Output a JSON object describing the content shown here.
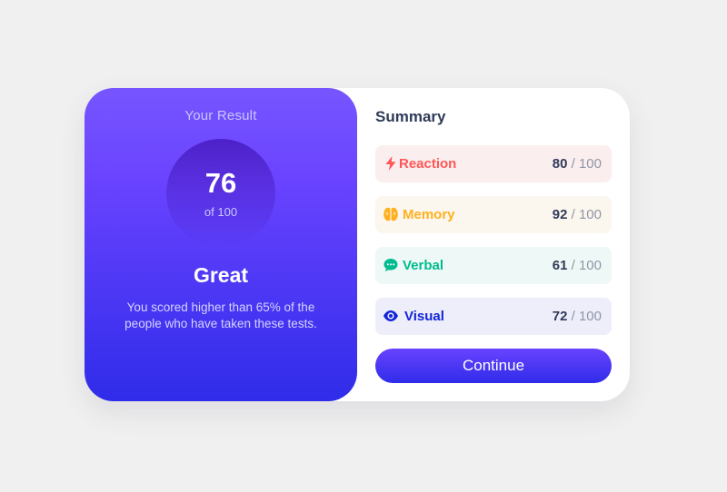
{
  "result": {
    "title": "Your Result",
    "score": "76",
    "out_of": "of 100",
    "rating": "Great",
    "description": "You scored higher than 65% of the people who have taken these tests."
  },
  "summary": {
    "title": "Summary",
    "items": [
      {
        "label": "Reaction",
        "score": "80",
        "max": "/ 100",
        "icon": "lightning-icon",
        "color": "#ff5757",
        "bg": "#fbeeee"
      },
      {
        "label": "Memory",
        "score": "92",
        "max": "/ 100",
        "icon": "brain-icon",
        "color": "#ffb01f",
        "bg": "#fbf6ee"
      },
      {
        "label": "Verbal",
        "score": "61",
        "max": "/ 100",
        "icon": "chat-bubble-icon",
        "color": "#00bb8f",
        "bg": "#eef8f6"
      },
      {
        "label": "Visual",
        "score": "72",
        "max": "/ 100",
        "icon": "eye-icon",
        "color": "#1125d6",
        "bg": "#eeeefb"
      }
    ]
  },
  "actions": {
    "continue_label": "Continue"
  },
  "colors": {
    "gradient_top": "#7755ff",
    "gradient_bottom": "#2f2ce9",
    "page_background": "#f0f0f0"
  }
}
